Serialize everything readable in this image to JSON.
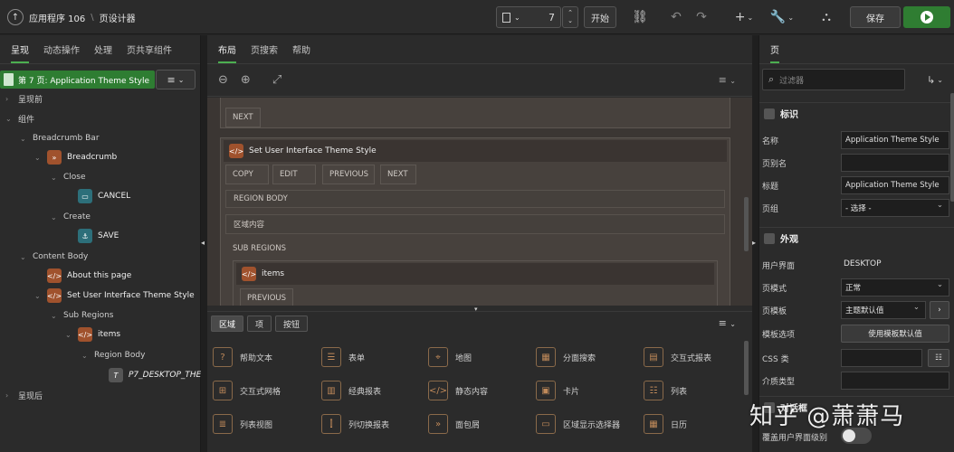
{
  "topbar": {
    "app": "应用程序 106",
    "page_designer": "页设计器",
    "page_number": "7",
    "start_label": "开始",
    "save_label": "保存"
  },
  "left": {
    "tabs": [
      "呈现",
      "动态操作",
      "处理",
      "页共享组件"
    ],
    "page_badge": "第 7 页: Application Theme Style",
    "tree": {
      "pre_render": "呈现前",
      "components": "组件",
      "breadcrumb_bar": "Breadcrumb Bar",
      "breadcrumb": "Breadcrumb",
      "close": "Close",
      "cancel": "CANCEL",
      "create": "Create",
      "save": "SAVE",
      "content_body": "Content Body",
      "about": "About this page",
      "set_theme": "Set User Interface Theme Style",
      "sub_regions": "Sub Regions",
      "items": "items",
      "region_body": "Region Body",
      "p7_item": "P7_DESKTOP_THEM",
      "post_render": "呈现后"
    }
  },
  "center": {
    "tabs": [
      "布局",
      "页搜索",
      "帮助"
    ],
    "canvas": {
      "next_top": "NEXT",
      "region_title": "Set User Interface Theme Style",
      "buttons": [
        "COPY",
        "EDIT",
        "PREVIOUS",
        "NEXT"
      ],
      "region_body": "REGION BODY",
      "region_content": "区域内容",
      "sub_regions": "SUB REGIONS",
      "items_title": "items",
      "previous": "PREVIOUS"
    },
    "gallery_tabs": [
      "区域",
      "项",
      "按钮"
    ],
    "gallery": [
      [
        "帮助文本",
        "表单",
        "地图",
        "分面搜索",
        "交互式报表"
      ],
      [
        "交互式网格",
        "经典报表",
        "静态内容",
        "卡片",
        "列表"
      ],
      [
        "列表视图",
        "列切换报表",
        "面包屑",
        "区域显示选择器",
        "日历"
      ]
    ]
  },
  "right": {
    "tab": "页",
    "filter_placeholder": "过滤器",
    "section_id": "标识",
    "name_label": "名称",
    "name_value": "Application Theme Style",
    "alias_label": "页别名",
    "title_label": "标题",
    "title_value": "Application Theme Style",
    "group_label": "页组",
    "group_value": "- 选择 -",
    "section_appearance": "外观",
    "ui_label": "用户界面",
    "ui_value": "DESKTOP",
    "mode_label": "页模式",
    "mode_value": "正常",
    "template_label": "页模板",
    "template_value": "主题默认值",
    "template_options_label": "模板选项",
    "template_options_button": "使用模板默认值",
    "css_label": "CSS 类",
    "media_label": "介质类型",
    "dialog_label": "对话框",
    "override_label": "覆盖用户界面级别"
  },
  "watermark": "知乎 @萧萧马"
}
